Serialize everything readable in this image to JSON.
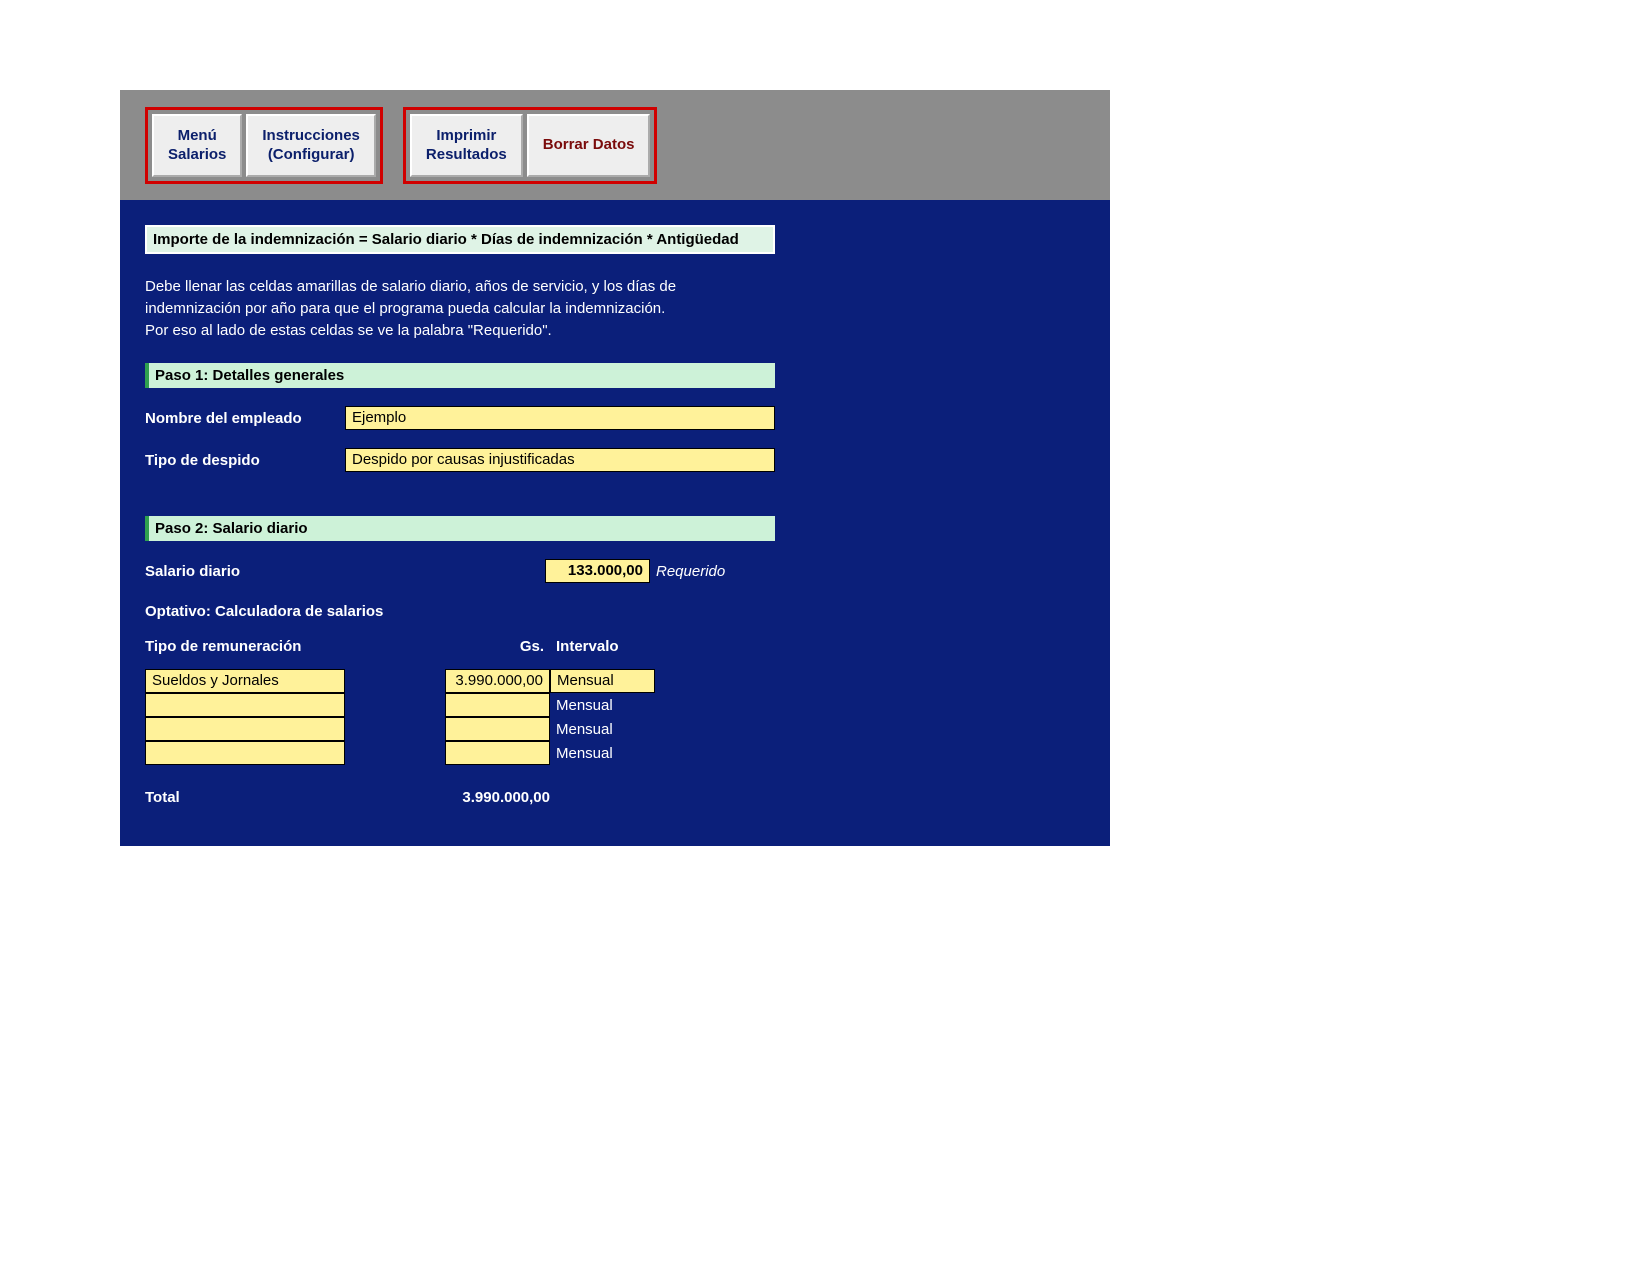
{
  "toolbar": {
    "groups": [
      {
        "buttons": [
          {
            "label": "Menú\nSalarios",
            "color": "navy",
            "name": "menu-salarios-button"
          },
          {
            "label": "Instrucciones\n(Configurar)",
            "color": "navy",
            "name": "instrucciones-button"
          }
        ]
      },
      {
        "buttons": [
          {
            "label": "Imprimir\nResultados",
            "color": "navy",
            "name": "imprimir-button"
          },
          {
            "label": "Borrar Datos",
            "color": "maroon",
            "name": "borrar-datos-button"
          }
        ]
      }
    ]
  },
  "formula": "Importe de la indemnización = Salario diario * Días de indemnización * Antigüedad",
  "intro": "Debe llenar las celdas amarillas de salario diario, años de servicio, y los días de\nindemnización por año para que el programa pueda calcular la indemnización.\nPor eso al lado de estas celdas se ve la palabra \"Requerido\".",
  "step1": {
    "title": "Paso 1: Detalles generales",
    "nombre": {
      "label": "Nombre del empleado",
      "value": "Ejemplo"
    },
    "tipo_despido": {
      "label": "Tipo de despido",
      "value": "Despido por causas injustificadas"
    }
  },
  "step2": {
    "title": "Paso 2: Salario diario",
    "salario": {
      "label": "Salario diario",
      "value": "133.000,00",
      "required": "Requerido"
    },
    "calc_title": "Optativo: Calculadora de salarios",
    "headers": {
      "tipo": "Tipo de remuneración",
      "gs": "Gs.",
      "interval": "Intervalo"
    },
    "rows": [
      {
        "tipo": "Sueldos y Jornales",
        "gs": "3.990.000,00",
        "interval": "Mensual",
        "interval_yellow": true
      },
      {
        "tipo": "",
        "gs": "",
        "interval": "Mensual",
        "interval_yellow": false
      },
      {
        "tipo": "",
        "gs": "",
        "interval": "Mensual",
        "interval_yellow": false
      },
      {
        "tipo": "",
        "gs": "",
        "interval": "Mensual",
        "interval_yellow": false
      }
    ],
    "total": {
      "label": "Total",
      "value": "3.990.000,00"
    }
  }
}
